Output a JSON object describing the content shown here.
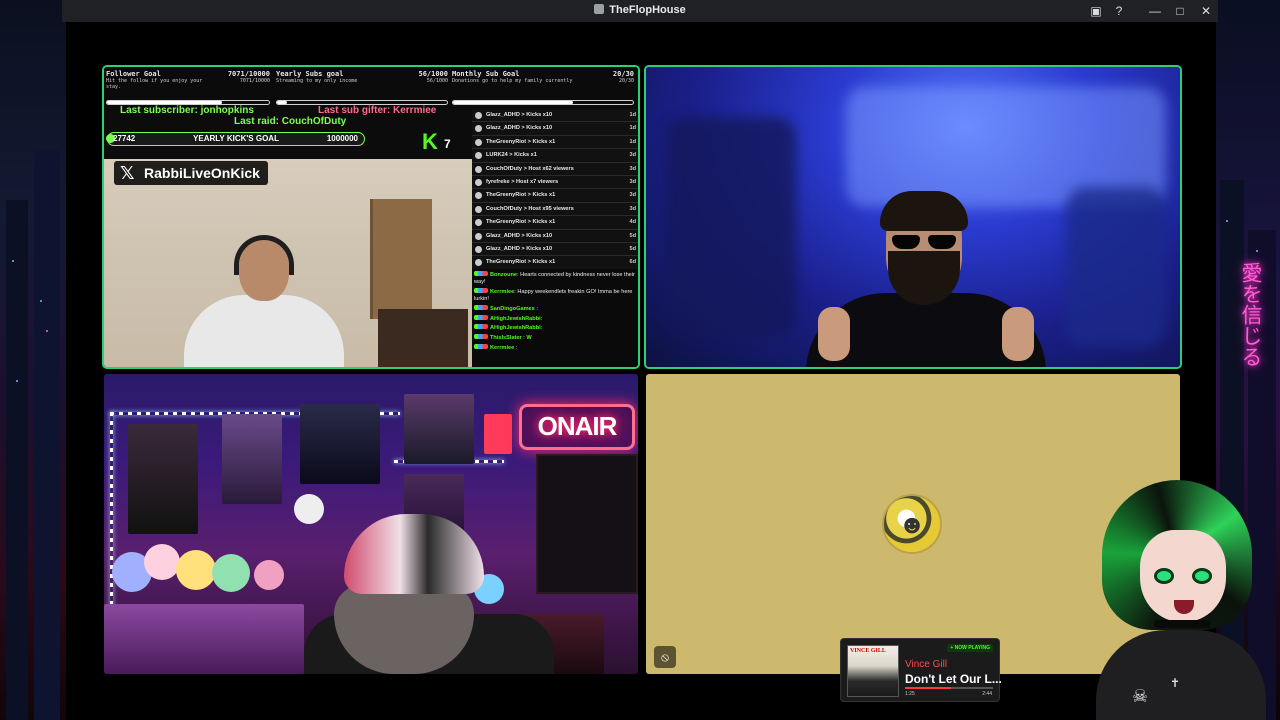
{
  "window": {
    "title": "TheFlopHouse",
    "icons": [
      "app-icon",
      "cast-icon",
      "help-icon",
      "minimize-icon",
      "maximize-icon",
      "close-icon"
    ]
  },
  "background": {
    "neon_text": "愛を信じる"
  },
  "tile1": {
    "goals": [
      {
        "name": "Follower Goal",
        "value": "7071/10000",
        "desc": "Hit the follow if you enjoy your stay.",
        "value2": "7071/10000",
        "progress": 0.7071
      },
      {
        "name": "Yearly Subs goal",
        "value": "56/1000",
        "desc": "Streaming to my only income",
        "value2": "56/1000",
        "progress": 0.056
      },
      {
        "name": "Monthly Sub Goal",
        "value": "20/30",
        "desc": "Donations go to help my family currently",
        "value2": "20/30",
        "progress": 0.6667
      }
    ],
    "last_subscriber": "Last subscriber: jonhopkins",
    "last_sub_gifter": "Last sub gifter: Kerrmiee",
    "last_raid": "Last raid: CouchOfDuty",
    "kick_goal": {
      "current": "27742",
      "name": "YEARLY KICK'S GOAL",
      "target": "1000000"
    },
    "kick_badge": "K",
    "kick_count": "7",
    "handle": "RabbiLiveOnKick",
    "events": [
      {
        "text": "Glazz_ADHD > Kicks x10",
        "time": "1d"
      },
      {
        "text": "Glazz_ADHD > Kicks x10",
        "time": "1d"
      },
      {
        "text": "TheGreenyRiot > Kicks x1",
        "time": "1d"
      },
      {
        "text": "LURK24 > Kicks x1",
        "time": "3d"
      },
      {
        "text": "CouchOfDuty > Host x62 viewers",
        "time": "3d"
      },
      {
        "text": "fyrefreke > Host x7 viewers",
        "time": "3d"
      },
      {
        "text": "TheGreenyRiot > Kicks x1",
        "time": "3d"
      },
      {
        "text": "CouchOfDuty > Host x95 viewers",
        "time": "3d"
      },
      {
        "text": "TheGreenyRiot > Kicks x1",
        "time": "4d"
      },
      {
        "text": "Glazz_ADHD > Kicks x10",
        "time": "5d"
      },
      {
        "text": "Glazz_ADHD > Kicks x10",
        "time": "5d"
      },
      {
        "text": "TheGreenyRiot > Kicks x1",
        "time": "6d"
      }
    ],
    "chat": [
      {
        "user": "Bonzoune",
        "text": "Hearts connected by kindness never lose their way!"
      },
      {
        "user": "Kerrmiee",
        "text": "Happy weekendlets freakin GO! Imma be here lurkin!"
      },
      {
        "user": "SanDingoGames",
        "text": ""
      },
      {
        "user": "AHighJewishRabbi",
        "text": ""
      },
      {
        "user": "AHighJewishRabbi",
        "text": ""
      },
      {
        "user": "ThisIsSlater",
        "text": "W"
      },
      {
        "user": "Kerrmiee",
        "text": ""
      }
    ]
  },
  "tile3": {
    "onair_sign": "ONAIR"
  },
  "tile4": {
    "icons": [
      "avatar-icon",
      "mic-off-icon"
    ]
  },
  "now_playing": {
    "tag": "+ NOW PLAYING",
    "cover_text": "VINCE GILL",
    "artist": "Vince Gill",
    "song": "Don't Let Our L...",
    "elapsed": "1:25",
    "duration": "2:44",
    "progress": 0.52,
    "accent": "#ff3a3a"
  },
  "colors": {
    "active_border": "#2ecf73",
    "kick_green": "#53fc18",
    "tile4_bg": "#cdb96e",
    "titlebar": "#202124"
  }
}
